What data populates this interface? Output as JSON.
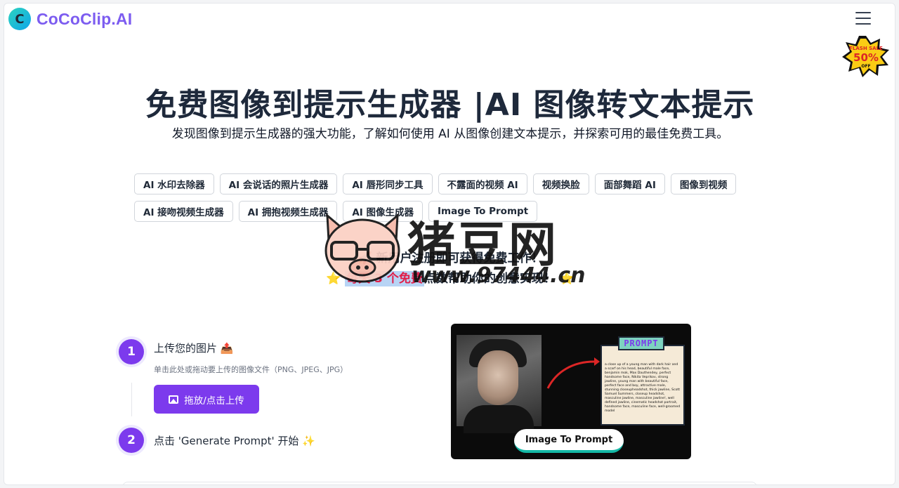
{
  "header": {
    "logo_letter": "C",
    "logo_text": "CoCoClip.AI"
  },
  "badge": {
    "line1": "FLASH SALE",
    "line2": "50%",
    "line3": "OFF"
  },
  "hero": {
    "title": "免费图像到提示生成器 |AI 图像转文本提示",
    "subtitle": "发现图像到提示生成器的强大功能，了解如何使用 AI 从图像创建文本提示，并探索可用的最佳免费工具。"
  },
  "tags": [
    "AI 水印去除器",
    "AI 会说话的照片生成器",
    "AI 唇形同步工具",
    "不露面的视频 AI",
    "视频换脸",
    "面部舞蹈 AI",
    "图像到视频",
    "AI 接吻视频生成器",
    "AI 拥抱视频生成器",
    "AI 图像生成器",
    "Image To Prompt"
  ],
  "promo": {
    "line1_prefix": "🚀",
    "line1": "新用户注册即可获得免费工作！",
    "line2_prefix": "⭐",
    "line2_highlight": "每天 3 个免费",
    "line2_rest": "点数帮助你的创意实现！",
    "line2_suffix": "⭐"
  },
  "watermark": {
    "text": "猪豆网",
    "url": "www.97444.cn"
  },
  "steps": [
    {
      "num": "1",
      "title": "上传您的图片 📤",
      "desc": "单击此处或拖动要上传的图像文件（PNG、JPEG、JPG）"
    },
    {
      "num": "2",
      "title": "点击 'Generate Prompt' 开始 ✨"
    }
  ],
  "upload_button": "拖放/点击上传",
  "preview": {
    "tag": "PROMPT",
    "prompt_text": "a close up of a young man with dark hair and a scarf on his head, beautiful male face, benjamin mok, Max Dauthendey, perfect handsome face, Nikita Veprikov, strong jawline, young man with beautiful face, perfect face and boy, attractive male, stunning closeupheadshot, thick jawline, Scott Samuel Summers, closeup headshot, masculine jawline, masculine jawline!, well defined jawline, cinematic headshot portrait, handsome face, masculine face, well-groomed model",
    "button": "Image To Prompt"
  }
}
